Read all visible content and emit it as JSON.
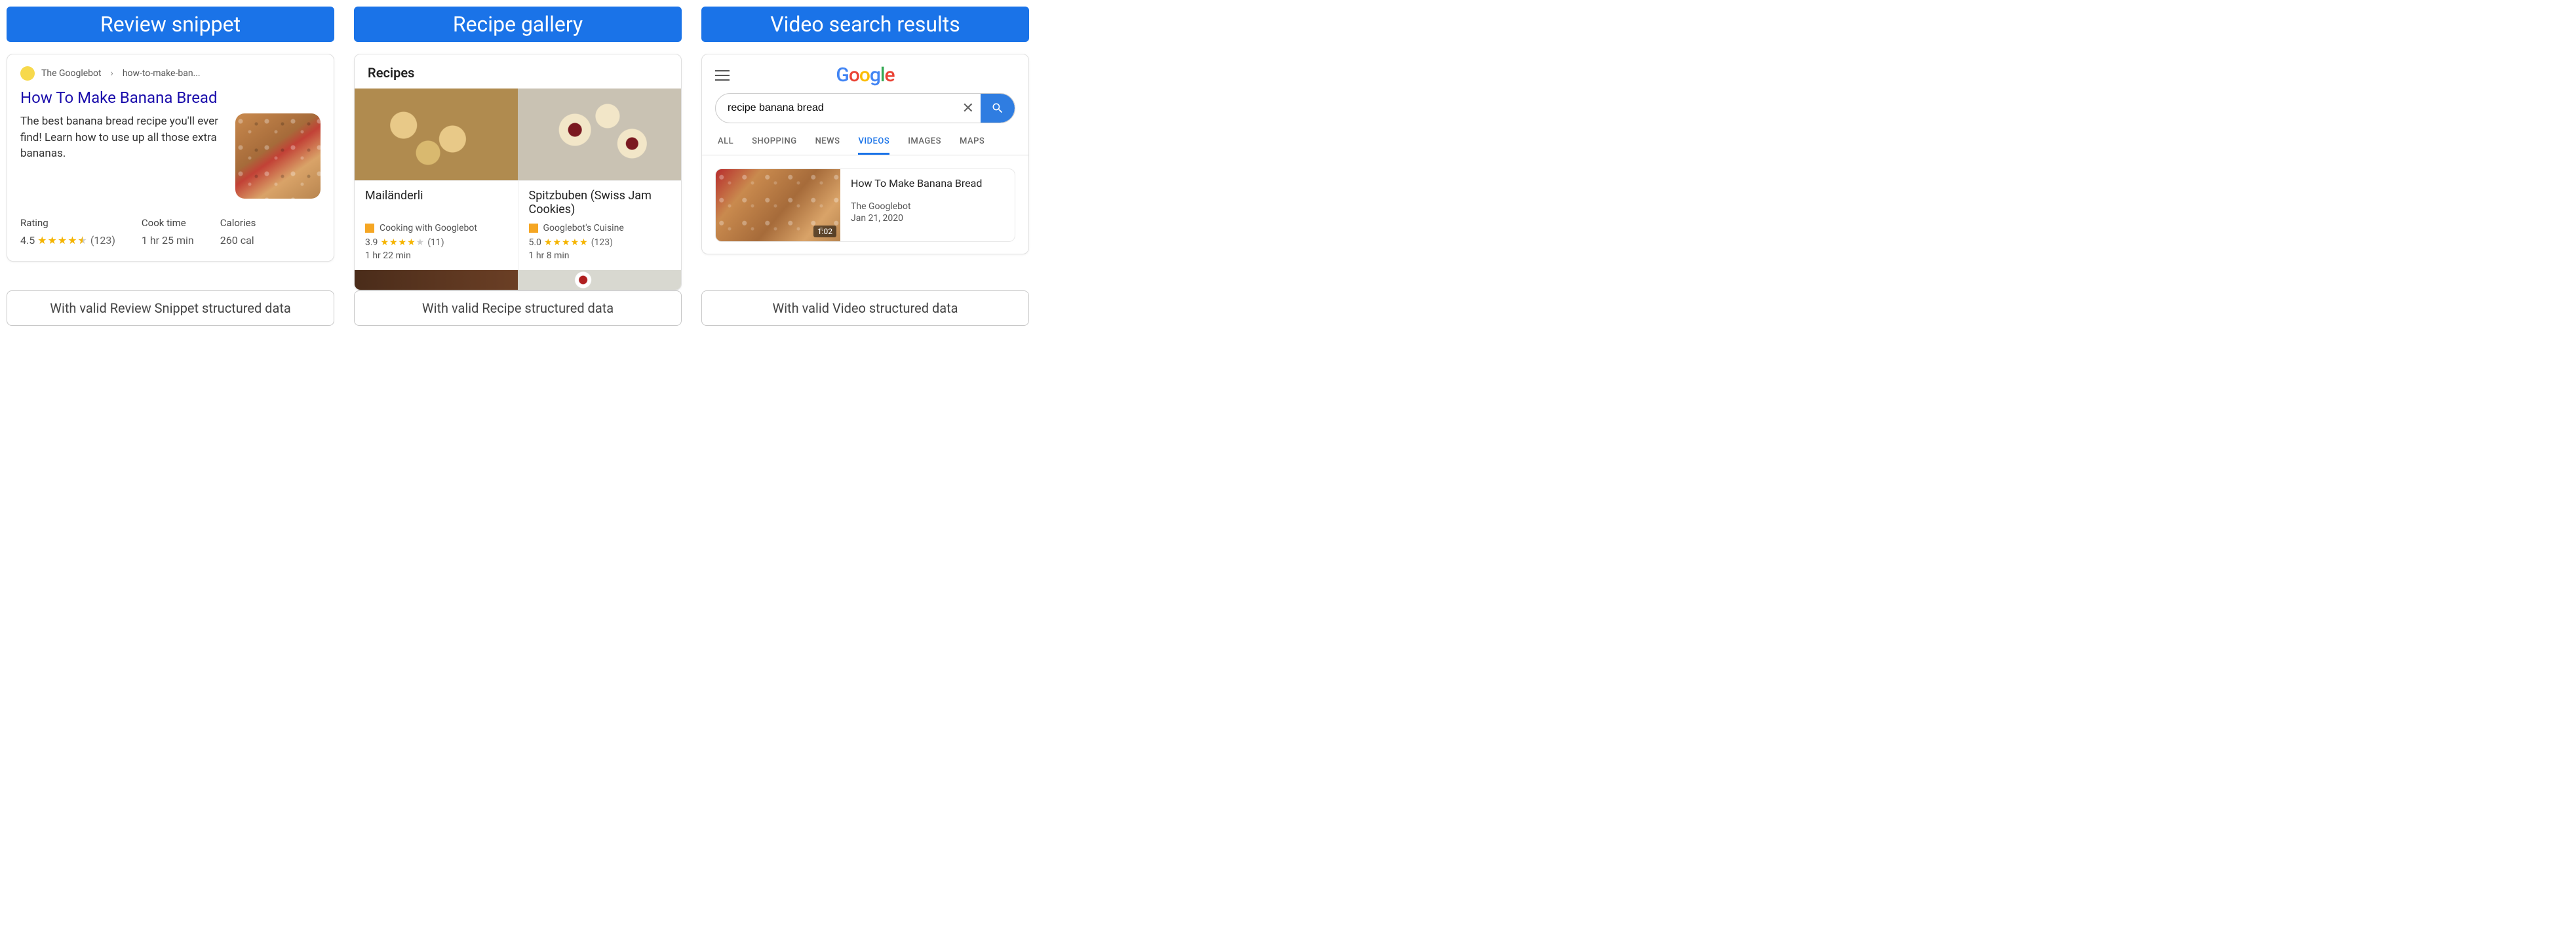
{
  "columns": {
    "review": {
      "banner": "Review snippet",
      "breadcrumb_site": "The Googlebot",
      "breadcrumb_path": "how-to-make-ban...",
      "title": "How To Make Banana Bread",
      "description": "The best banana bread recipe you'll ever find! Learn how to use up all those extra bananas.",
      "meta": {
        "rating_label": "Rating",
        "rating_value": "4.5",
        "rating_count": "(123)",
        "cook_label": "Cook time",
        "cook_value": "1 hr 25 min",
        "cal_label": "Calories",
        "cal_value": "260 cal"
      },
      "footer": "With valid Review Snippet structured data"
    },
    "gallery": {
      "banner": "Recipe gallery",
      "heading": "Recipes",
      "items": [
        {
          "name": "Mailänderli",
          "source": "Cooking with Googlebot",
          "rating": "3.9",
          "count": "(11)",
          "stars_full": 4,
          "stars_empty": 1,
          "time": "1 hr 22 min"
        },
        {
          "name": "Spitzbuben (Swiss Jam Cookies)",
          "source": "Googlebot's Cuisine",
          "rating": "5.0",
          "count": "(123)",
          "stars_full": 5,
          "stars_empty": 0,
          "time": "1 hr 8 min"
        }
      ],
      "footer": "With valid Recipe structured data"
    },
    "video": {
      "banner": "Video search results",
      "search_value": "recipe banana bread",
      "tabs": [
        "ALL",
        "SHOPPING",
        "NEWS",
        "VIDEOS",
        "IMAGES",
        "MAPS"
      ],
      "active_tab": "VIDEOS",
      "result": {
        "title": "How To Make Banana Bread",
        "source": "The Googlebot",
        "date": "Jan 21, 2020",
        "duration": "1:02"
      },
      "footer": "With valid Video structured data"
    }
  }
}
